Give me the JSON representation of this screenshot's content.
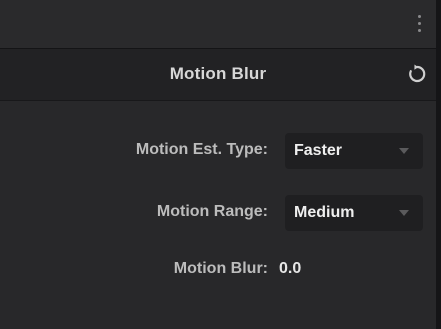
{
  "panel": {
    "title": "Motion Blur",
    "fields": {
      "est_type": {
        "label": "Motion Est. Type:",
        "value": "Faster"
      },
      "range": {
        "label": "Motion Range:",
        "value": "Medium"
      },
      "blur": {
        "label": "Motion Blur:",
        "value": "0.0"
      }
    }
  },
  "icons": {
    "menu": "kebab-menu-icon",
    "reset": "reset-icon",
    "dropdown": "chevron-down-icon"
  }
}
